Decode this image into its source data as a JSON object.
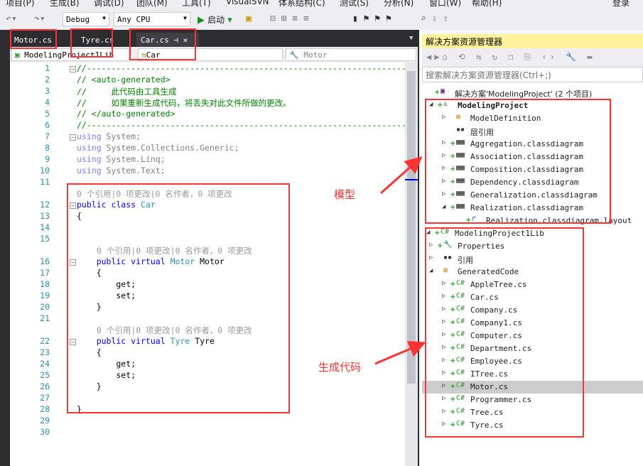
{
  "menu": [
    "项目(P)",
    "生成(B)",
    "调试(D)",
    "团队(M)",
    "工具(T)",
    "VisualSVN",
    "体系结构(C)",
    "测试(S)",
    "分析(N)",
    "窗口(W)",
    "帮助(H)",
    "登录"
  ],
  "toolbar": {
    "config": "Debug",
    "platform": "Any CPU",
    "start": "启动"
  },
  "tabs": [
    {
      "label": "Motor.cs"
    },
    {
      "label": "Tyre.cs"
    },
    {
      "label": "Car.cs",
      "active": true
    }
  ],
  "nav": {
    "project": "ModelingProject1Lib",
    "type": "Car",
    "member": "Motor"
  },
  "lens": "0 个引用|0 项更改|0 名作者，0 项更改",
  "code": [
    {
      "n": "1",
      "fold": true,
      "s": [
        [
          "//------------------------------------------------------------------------",
          "cm"
        ]
      ]
    },
    {
      "n": "2",
      "s": [
        [
          "// <auto-generated>",
          "cm"
        ]
      ]
    },
    {
      "n": "3",
      "s": [
        [
          "//     此代码由工具生成",
          "cm"
        ]
      ]
    },
    {
      "n": "4",
      "s": [
        [
          "//     如果重新生成代码，将丢失对此文件所做的更改。",
          "cm"
        ]
      ]
    },
    {
      "n": "5",
      "s": [
        [
          "// </auto-generated>",
          "cm"
        ]
      ]
    },
    {
      "n": "6",
      "s": [
        [
          "//------------------------------------------------------------------------",
          "cm"
        ]
      ]
    },
    {
      "n": "7",
      "fold": true,
      "s": [
        [
          "using",
          "gk"
        ],
        [
          " System;",
          "gr"
        ]
      ]
    },
    {
      "n": "8",
      "s": [
        [
          "using",
          "gk"
        ],
        [
          " System.Collections.Generic;",
          "gr"
        ]
      ]
    },
    {
      "n": "9",
      "s": [
        [
          "using",
          "gk"
        ],
        [
          " System.Linq;",
          "gr"
        ]
      ]
    },
    {
      "n": "10",
      "s": [
        [
          "using",
          "gk"
        ],
        [
          " System.Text;",
          "gr"
        ]
      ]
    },
    {
      "n": "11",
      "s": []
    },
    {
      "lens": true,
      "indent": 0
    },
    {
      "n": "12",
      "fold": true,
      "s": [
        [
          "public class ",
          "kw"
        ],
        [
          "Car",
          "ty"
        ]
      ]
    },
    {
      "n": "13",
      "s": [
        [
          "{",
          ""
        ]
      ]
    },
    {
      "n": "14",
      "s": []
    },
    {
      "n": "15",
      "s": []
    },
    {
      "lens": true,
      "indent": 4
    },
    {
      "n": "16",
      "fold": true,
      "s": [
        [
          "    public virtual ",
          "kw"
        ],
        [
          "Motor",
          "ty"
        ],
        [
          " Motor",
          ""
        ]
      ]
    },
    {
      "n": "17",
      "s": [
        [
          "    {",
          ""
        ]
      ]
    },
    {
      "n": "18",
      "s": [
        [
          "        get",
          ""
        ],
        [
          ";",
          ""
        ]
      ]
    },
    {
      "n": "19",
      "s": [
        [
          "        set",
          ""
        ],
        [
          ";",
          ""
        ]
      ]
    },
    {
      "n": "20",
      "s": [
        [
          "    }",
          ""
        ]
      ]
    },
    {
      "n": "21",
      "s": []
    },
    {
      "lens": true,
      "indent": 4
    },
    {
      "n": "22",
      "fold": true,
      "s": [
        [
          "    public virtual ",
          "kw"
        ],
        [
          "Tyre",
          "ty"
        ],
        [
          " Tyre",
          ""
        ]
      ]
    },
    {
      "n": "23",
      "s": [
        [
          "    {",
          ""
        ]
      ]
    },
    {
      "n": "24",
      "s": [
        [
          "        get",
          ""
        ],
        [
          ";",
          ""
        ]
      ]
    },
    {
      "n": "25",
      "s": [
        [
          "        set",
          ""
        ],
        [
          ";",
          ""
        ]
      ]
    },
    {
      "n": "26",
      "s": [
        [
          "    }",
          ""
        ]
      ]
    },
    {
      "n": "27",
      "s": []
    },
    {
      "n": "28",
      "s": [
        [
          "}",
          ""
        ]
      ]
    },
    {
      "n": "29",
      "s": []
    },
    {
      "n": "30",
      "s": []
    }
  ],
  "solution_explorer": {
    "title": "解决方案资源管理器",
    "search_placeholder": "搜索解决方案资源管理器(Ctrl+;)",
    "items": [
      {
        "label": "解决方案'ModelingProject' (2 个项目)",
        "level": 0,
        "arrow": "",
        "icon": "solution-icon",
        "plus": true
      },
      {
        "label": "ModelingProject",
        "level": 1,
        "arrow": "expanded",
        "icon": "model-project-icon",
        "plus": true,
        "bold": true
      },
      {
        "label": "ModelDefinition",
        "level": 2,
        "arrow": "collapsed",
        "icon": "folder-icon"
      },
      {
        "label": "层引用",
        "level": 2,
        "arrow": "",
        "icon": "reference-icon"
      },
      {
        "label": "Aggregation.classdiagram",
        "level": 2,
        "arrow": "collapsed",
        "icon": "classdiagram-icon",
        "plus": true
      },
      {
        "label": "Association.classdiagram",
        "level": 2,
        "arrow": "collapsed",
        "icon": "classdiagram-icon",
        "plus": true
      },
      {
        "label": "Composition.classdiagram",
        "level": 2,
        "arrow": "collapsed",
        "icon": "classdiagram-icon",
        "plus": true
      },
      {
        "label": "Dependency.classdiagram",
        "level": 2,
        "arrow": "collapsed",
        "icon": "classdiagram-icon",
        "plus": true
      },
      {
        "label": "Generalization.classdiagram",
        "level": 2,
        "arrow": "collapsed",
        "icon": "classdiagram-icon",
        "plus": true
      },
      {
        "label": "Realization.classdiagram",
        "level": 2,
        "arrow": "expanded",
        "icon": "classdiagram-icon",
        "plus": true
      },
      {
        "label": "Realization.classdiagram.layout",
        "level": 3,
        "arrow": "",
        "icon": "layout-icon",
        "plus": true
      },
      {
        "label": "ModelingProject1Lib",
        "level": 0,
        "arrow": "expanded",
        "icon": "csharp-project-icon",
        "plus": true
      },
      {
        "label": "Properties",
        "level": 1,
        "arrow": "collapsed",
        "icon": "wrench-icon",
        "plus": true
      },
      {
        "label": "引用",
        "level": 1,
        "arrow": "collapsed",
        "icon": "reference-icon"
      },
      {
        "label": "GeneratedCode",
        "level": 1,
        "arrow": "expanded",
        "icon": "folder-icon"
      },
      {
        "label": "AppleTree.cs",
        "level": 2,
        "arrow": "collapsed",
        "icon": "csharp-file-icon",
        "plus": true
      },
      {
        "label": "Car.cs",
        "level": 2,
        "arrow": "collapsed",
        "icon": "csharp-file-icon",
        "plus": true
      },
      {
        "label": "Company.cs",
        "level": 2,
        "arrow": "collapsed",
        "icon": "csharp-file-icon",
        "plus": true
      },
      {
        "label": "Company1.cs",
        "level": 2,
        "arrow": "collapsed",
        "icon": "csharp-file-icon",
        "plus": true
      },
      {
        "label": "Computer.cs",
        "level": 2,
        "arrow": "collapsed",
        "icon": "csharp-file-icon",
        "plus": true
      },
      {
        "label": "Department.cs",
        "level": 2,
        "arrow": "collapsed",
        "icon": "csharp-file-icon",
        "plus": true
      },
      {
        "label": "Employee.cs",
        "level": 2,
        "arrow": "collapsed",
        "icon": "csharp-file-icon",
        "plus": true
      },
      {
        "label": "ITree.cs",
        "level": 2,
        "arrow": "collapsed",
        "icon": "csharp-file-icon",
        "plus": true
      },
      {
        "label": "Motor.cs",
        "level": 2,
        "arrow": "collapsed",
        "icon": "csharp-file-icon",
        "plus": true,
        "selected": true
      },
      {
        "label": "Programmer.cs",
        "level": 2,
        "arrow": "collapsed",
        "icon": "csharp-file-icon",
        "plus": true
      },
      {
        "label": "Tree.cs",
        "level": 2,
        "arrow": "collapsed",
        "icon": "csharp-file-icon",
        "plus": true
      },
      {
        "label": "Tyre.cs",
        "level": 2,
        "arrow": "collapsed",
        "icon": "csharp-file-icon",
        "plus": true
      }
    ]
  },
  "annotations": {
    "model": "模型",
    "generated": "生成代码",
    "color": "#ff3333"
  }
}
